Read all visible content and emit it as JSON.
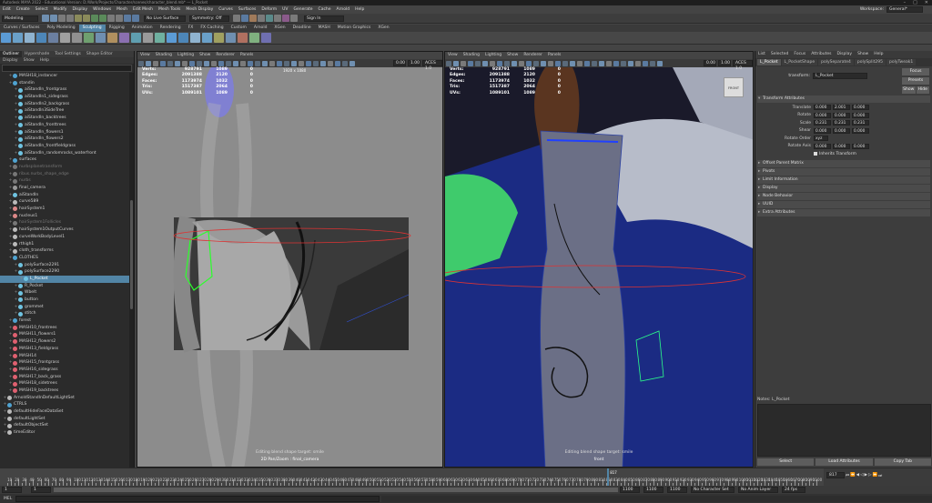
{
  "title_bar": {
    "text": "Autodesk MAYA 2022 - Educational Version: D:/Work/Projects/Character/scenes/character_blend.mb* --- L_Pocket"
  },
  "menubar": {
    "items": [
      "Edit",
      "Create",
      "Select",
      "Modify",
      "Display",
      "Windows",
      "Mesh",
      "Edit Mesh",
      "Mesh Tools",
      "Mesh Display",
      "Curves",
      "Surfaces",
      "Deform",
      "UV",
      "Generate",
      "Cache",
      "Arnold",
      "Help"
    ],
    "workspace_label": "Workspace:",
    "workspace_value": "General*"
  },
  "statusline": {
    "mode": "Modeling",
    "live": "No Live Surface",
    "symmetry": "Symmetry: Off",
    "signin": "Sign In"
  },
  "shelf_tabs": {
    "items": [
      "Curves / Surfaces",
      "Poly Modeling",
      "Sculpting",
      "Rigging",
      "Animation",
      "Rendering",
      "FX",
      "FX Caching",
      "Custom",
      "Arnold",
      "XGen",
      "Deadline",
      "MASH",
      "Motion Graphics",
      "XGen"
    ],
    "active": 2
  },
  "outliner": {
    "tabs": [
      "Outliner",
      "Hypershade",
      "Tool Settings",
      "Shape Editor"
    ],
    "menu": [
      "Display",
      "Show",
      "Help"
    ],
    "items": [
      {
        "label": "MASH18_instancer",
        "indent": 1,
        "icon": "#4fa3d1"
      },
      {
        "label": "standin",
        "indent": 1,
        "icon": "#4fa3d1"
      },
      {
        "label": "aiStandIn_frontgrass",
        "indent": 2,
        "icon": "#6fc3e1"
      },
      {
        "label": "aiStandIn1_sidegrass",
        "indent": 2,
        "icon": "#6fc3e1"
      },
      {
        "label": "aiStandIn2_backgrass",
        "indent": 2,
        "icon": "#6fc3e1"
      },
      {
        "label": "aiStandIn3SideTree",
        "indent": 2,
        "icon": "#6fc3e1"
      },
      {
        "label": "aiStandIn_backtrees",
        "indent": 2,
        "icon": "#6fc3e1"
      },
      {
        "label": "aiStandIn_fronttrees",
        "indent": 2,
        "icon": "#6fc3e1"
      },
      {
        "label": "aiStandIn_flowers1",
        "indent": 2,
        "icon": "#6fc3e1"
      },
      {
        "label": "aiStandIn_flowers2",
        "indent": 2,
        "icon": "#6fc3e1"
      },
      {
        "label": "aiStandIn_frontfieldgrass",
        "indent": 2,
        "icon": "#6fc3e1"
      },
      {
        "label": "aiStandIn_randomrocks_waterfront",
        "indent": 2,
        "icon": "#6fc3e1"
      },
      {
        "label": "surfaces",
        "indent": 1,
        "icon": "#4fa3d1"
      },
      {
        "label": "nurbsplanetransform",
        "indent": 1,
        "icon": "#777",
        "dim": true
      },
      {
        "label": "ribus.nurbs_shape_edge",
        "indent": 1,
        "icon": "#777",
        "dim": true
      },
      {
        "label": "nurbs",
        "indent": 1,
        "icon": "#777",
        "dim": true
      },
      {
        "label": "final_camera",
        "indent": 1,
        "icon": "#999"
      },
      {
        "label": "aiStandIn",
        "indent": 1,
        "icon": "#6fc3e1"
      },
      {
        "label": "curve589",
        "indent": 1,
        "icon": "#bbb"
      },
      {
        "label": "hairSystem1",
        "indent": 1,
        "icon": "#d88"
      },
      {
        "label": "nucleus1",
        "indent": 1,
        "icon": "#d88"
      },
      {
        "label": "hairSystem1Follicles",
        "indent": 1,
        "icon": "#777",
        "dim": true
      },
      {
        "label": "hairSystem1OutputCurves",
        "indent": 1,
        "icon": "#bbb"
      },
      {
        "label": "curveWorkBodyLevel1",
        "indent": 1,
        "icon": "#bbb"
      },
      {
        "label": "rthigh1",
        "indent": 1,
        "icon": "#bbb"
      },
      {
        "label": "cloth_transforms",
        "indent": 1,
        "icon": "#bbb"
      },
      {
        "label": "CLOTHES",
        "indent": 1,
        "icon": "#4fa3d1"
      },
      {
        "label": "polySurface2291",
        "indent": 2,
        "icon": "#6fc3e1"
      },
      {
        "label": "polySurface2290",
        "indent": 2,
        "icon": "#6fc3e1"
      },
      {
        "label": "L_Pocket",
        "indent": 3,
        "icon": "#6fc3e1",
        "selected": true
      },
      {
        "label": "R_Pocket",
        "indent": 2,
        "icon": "#6fc3e1"
      },
      {
        "label": "Wbelt",
        "indent": 2,
        "icon": "#6fc3e1"
      },
      {
        "label": "button",
        "indent": 2,
        "icon": "#6fc3e1"
      },
      {
        "label": "grommet",
        "indent": 2,
        "icon": "#6fc3e1"
      },
      {
        "label": "stitch",
        "indent": 2,
        "icon": "#6fc3e1"
      },
      {
        "label": "forest",
        "indent": 1,
        "icon": "#4fa3d1"
      },
      {
        "label": "MASH10_frontrees",
        "indent": 1,
        "icon": "#e06070"
      },
      {
        "label": "MASH11_flowers1",
        "indent": 1,
        "icon": "#e06070"
      },
      {
        "label": "MASH12_flowers2",
        "indent": 1,
        "icon": "#e06070"
      },
      {
        "label": "MASH13_fieldgrass",
        "indent": 1,
        "icon": "#e06070"
      },
      {
        "label": "MASH14",
        "indent": 1,
        "icon": "#e06070"
      },
      {
        "label": "MASH15_frontgrass",
        "indent": 1,
        "icon": "#e06070"
      },
      {
        "label": "MASH16_sidegrass",
        "indent": 1,
        "icon": "#e06070"
      },
      {
        "label": "MASH17_back_grass",
        "indent": 1,
        "icon": "#e06070"
      },
      {
        "label": "MASH18_sidetrees",
        "indent": 1,
        "icon": "#e06070"
      },
      {
        "label": "MASH19_backtrees",
        "indent": 1,
        "icon": "#e06070"
      },
      {
        "label": "ArnoldStandInDefaultLightSet",
        "indent": 0,
        "icon": "#bbb"
      },
      {
        "label": "CTRLS",
        "indent": 0,
        "icon": "#4fa3d1"
      },
      {
        "label": "defaultHideFaceDataSet",
        "indent": 0,
        "icon": "#bbb"
      },
      {
        "label": "defaultLightSet",
        "indent": 0,
        "icon": "#bbb"
      },
      {
        "label": "defaultObjectSet",
        "indent": 0,
        "icon": "#bbb"
      },
      {
        "label": "timeEditor",
        "indent": 0,
        "icon": "#bbb"
      }
    ]
  },
  "viewport_left": {
    "menu": [
      "View",
      "Shading",
      "Lighting",
      "Show",
      "Renderer",
      "Panels"
    ],
    "resolution": "1920 x 1080",
    "hud": [
      {
        "label": "Verts:",
        "a": "928791",
        "b": "1089",
        "c": "0"
      },
      {
        "label": "Edges:",
        "a": "2091388",
        "b": "2120",
        "c": "0"
      },
      {
        "label": "Faces:",
        "a": "1173974",
        "b": "1032",
        "c": "0"
      },
      {
        "label": "Tris:",
        "a": "1517387",
        "b": "2064",
        "c": "0"
      },
      {
        "label": "UVs:",
        "a": "1089101",
        "b": "1089",
        "c": "0"
      }
    ],
    "caption1": "Editing blend shape target: smile",
    "caption2": "2D Pan/Zoom : final_camera",
    "values": {
      "a": "0.00",
      "b": "1.00",
      "cs": "ACES 1.0"
    }
  },
  "viewport_right": {
    "menu": [
      "View",
      "Shading",
      "Lighting",
      "Show",
      "Renderer",
      "Panels"
    ],
    "hud": [
      {
        "label": "Verts:",
        "a": "928791",
        "b": "1089",
        "c": "0"
      },
      {
        "label": "Edges:",
        "a": "2091388",
        "b": "2120",
        "c": "0"
      },
      {
        "label": "Faces:",
        "a": "1173974",
        "b": "1032",
        "c": "0"
      },
      {
        "label": "Tris:",
        "a": "1517387",
        "b": "2064",
        "c": "0"
      },
      {
        "label": "UVs:",
        "a": "1089101",
        "b": "1089",
        "c": "0"
      }
    ],
    "caption1": "Editing blend shape target: smile",
    "caption2": "front",
    "viewcube": "FRONT",
    "values": {
      "a": "0.00",
      "b": "1.00",
      "cs": "ACES 1.0"
    }
  },
  "attribute_editor": {
    "menu": [
      "List",
      "Selected",
      "Focus",
      "Attributes",
      "Display",
      "Show",
      "Help"
    ],
    "tabs": [
      "L_Pocket",
      "L_PocketShape",
      "polySeparate4",
      "polySplit295",
      "polyTweak1"
    ],
    "transform_label": "transform:",
    "transform_value": "L_Pocket",
    "buttons": {
      "focus": "Focus",
      "presets": "Presets",
      "show": "Show",
      "hide": "Hide"
    },
    "section_transform": "Transform Attributes",
    "rows": [
      {
        "label": "Translate",
        "v": [
          "0.000",
          "2.001",
          "0.000"
        ]
      },
      {
        "label": "Rotate",
        "v": [
          "0.000",
          "0.000",
          "0.000"
        ]
      },
      {
        "label": "Scale",
        "v": [
          "0.231",
          "0.231",
          "0.231"
        ]
      },
      {
        "label": "Shear",
        "v": [
          "0.000",
          "0.000",
          "0.000"
        ]
      }
    ],
    "rotate_order_label": "Rotate Order",
    "rotate_order_value": "xyz",
    "rotate_axis_label": "Rotate Axis",
    "rotate_axis_v": [
      "0.000",
      "0.000",
      "0.000"
    ],
    "inherits_label": "Inherits Transform",
    "offset_label": "Offset Parent Matrix",
    "sections": [
      "Pivots",
      "Limit Information",
      "Display",
      "Node Behavior",
      "UUID",
      "Extra Attributes"
    ],
    "notes_label": "Notes: L_Pocket",
    "bottom_buttons": [
      "Select",
      "Load Attributes",
      "Copy Tab"
    ]
  },
  "timeline": {
    "ticks": [
      "5",
      "10",
      "15",
      "20",
      "25",
      "30",
      "35",
      "40",
      "45",
      "50",
      "55",
      "60",
      "65",
      "70",
      "75",
      "80",
      "85",
      "90",
      "95",
      "100",
      "105",
      "110",
      "115",
      "120",
      "125",
      "130",
      "135",
      "140",
      "145",
      "150",
      "155",
      "160",
      "165",
      "170",
      "175",
      "180",
      "185",
      "190",
      "195",
      "200",
      "205",
      "210",
      "215",
      "220",
      "225",
      "230",
      "235",
      "240",
      "245",
      "250",
      "255",
      "260",
      "265",
      "270",
      "275",
      "280",
      "285",
      "290",
      "295",
      "300",
      "305",
      "310",
      "315",
      "320",
      "325",
      "330",
      "335",
      "340",
      "345",
      "350",
      "355",
      "360",
      "365",
      "370",
      "375",
      "380",
      "385",
      "390",
      "395",
      "400",
      "405",
      "410",
      "415",
      "420",
      "425",
      "430",
      "435",
      "440",
      "445",
      "450",
      "455",
      "460",
      "465",
      "470",
      "475",
      "480",
      "485",
      "490",
      "495",
      "500",
      "505",
      "510",
      "515",
      "520",
      "525",
      "530",
      "535",
      "540",
      "545",
      "550",
      "555",
      "560",
      "565",
      "570",
      "575",
      "580",
      "585",
      "590",
      "595",
      "600",
      "605",
      "610",
      "615",
      "620",
      "625",
      "630",
      "635",
      "640",
      "645",
      "650",
      "655",
      "660",
      "665",
      "670",
      "675",
      "680",
      "685",
      "690",
      "695",
      "700",
      "705",
      "710",
      "715",
      "720",
      "725",
      "730",
      "735",
      "740",
      "745",
      "750",
      "755",
      "760",
      "765",
      "770",
      "775",
      "780",
      "785",
      "790",
      "795",
      "800",
      "805",
      "810",
      "815",
      "820",
      "825",
      "830",
      "835",
      "840",
      "845",
      "850",
      "855",
      "860",
      "865",
      "870",
      "875",
      "880",
      "885",
      "890",
      "895",
      "900",
      "905",
      "910",
      "915",
      "920",
      "925",
      "930",
      "935",
      "940",
      "945",
      "950",
      "955",
      "960",
      "965",
      "970",
      "975",
      "980",
      "985",
      "990",
      "995",
      "1000",
      "1005",
      "1010",
      "1015",
      "1020",
      "1025",
      "1030",
      "1035",
      "1040",
      "1045",
      "1050",
      "1055",
      "1060",
      "1065",
      "1070",
      "1075",
      "1080",
      "1085",
      "1090",
      "1095",
      "1100"
    ],
    "current_frame": "817",
    "playhead_label": "817"
  },
  "range": {
    "start": "1",
    "start2": "1",
    "end": "1100",
    "end2": "1100",
    "end3": "1100",
    "character": "No Character Set",
    "anim_layer": "No Anim Layer",
    "fps": "24 fps"
  },
  "cmdline": {
    "lang": "MEL"
  }
}
